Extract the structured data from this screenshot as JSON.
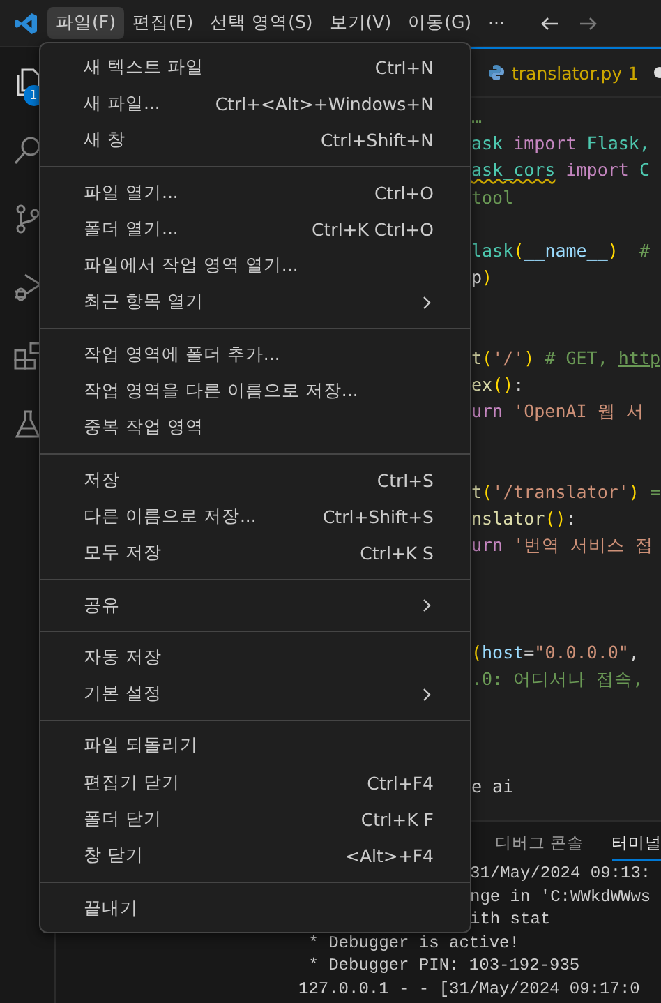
{
  "title_bar": {
    "menus": [
      {
        "label": "파일(F)",
        "selected": true
      },
      {
        "label": "편집(E)",
        "selected": false
      },
      {
        "label": "선택 영역(S)",
        "selected": false
      },
      {
        "label": "보기(V)",
        "selected": false
      },
      {
        "label": "이동(G)",
        "selected": false
      },
      {
        "label": "···",
        "selected": false
      }
    ]
  },
  "activity_bar": {
    "items": [
      {
        "kind": "files",
        "badge": "1"
      },
      {
        "kind": "search"
      },
      {
        "kind": "source-control"
      },
      {
        "kind": "debug"
      },
      {
        "kind": "extensions"
      },
      {
        "kind": "testing"
      }
    ]
  },
  "editor": {
    "tab": {
      "label": "translator.py 1",
      "modified": true
    },
    "lines": [
      {
        "kind": "code",
        "tokens": [
          {
            "kind": "comment",
            "text": "…"
          }
        ]
      },
      {
        "kind": "code",
        "tokens": [
          {
            "kind": "type",
            "text": "ask"
          },
          {
            "kind": "keyword",
            "text": " import "
          },
          {
            "kind": "type",
            "text": "Flask,"
          }
        ]
      },
      {
        "kind": "code",
        "tokens": [
          {
            "kind": "warning",
            "text": "ask_cors"
          },
          {
            "kind": "keyword",
            "text": " import "
          },
          {
            "kind": "type",
            "text": "C"
          }
        ]
      },
      {
        "kind": "code",
        "tokens": [
          {
            "kind": "comment",
            "text": "tool"
          }
        ]
      },
      {
        "kind": "blank"
      },
      {
        "kind": "code",
        "tokens": [
          {
            "kind": "type",
            "text": "lask"
          },
          {
            "kind": "bracket",
            "text": "("
          },
          {
            "kind": "variable",
            "text": "__name__"
          },
          {
            "kind": "bracket",
            "text": ")"
          },
          {
            "kind": "comment",
            "text": "  #"
          }
        ]
      },
      {
        "kind": "code",
        "tokens": [
          {
            "kind": "plain",
            "text": "p"
          },
          {
            "kind": "bracket",
            "text": ")"
          }
        ]
      },
      {
        "kind": "blank"
      },
      {
        "kind": "blank"
      },
      {
        "kind": "code",
        "tokens": [
          {
            "kind": "function",
            "text": "t"
          },
          {
            "kind": "bracket",
            "text": "("
          },
          {
            "kind": "string",
            "text": "'/'"
          },
          {
            "kind": "bracket",
            "text": ")"
          },
          {
            "kind": "comment",
            "text": " # GET, "
          },
          {
            "kind": "link",
            "text": "http"
          }
        ]
      },
      {
        "kind": "code",
        "tokens": [
          {
            "kind": "function",
            "text": "ex"
          },
          {
            "kind": "bracket",
            "text": "()"
          },
          {
            "kind": "plain",
            "text": ":"
          }
        ]
      },
      {
        "kind": "code",
        "tokens": [
          {
            "kind": "keyword",
            "text": "urn"
          },
          {
            "kind": "string",
            "text": " 'OpenAI 웹 서"
          }
        ]
      },
      {
        "kind": "blank"
      },
      {
        "kind": "blank"
      },
      {
        "kind": "code",
        "tokens": [
          {
            "kind": "function",
            "text": "t"
          },
          {
            "kind": "bracket",
            "text": "("
          },
          {
            "kind": "string",
            "text": "'/translator'"
          },
          {
            "kind": "bracket",
            "text": ")"
          },
          {
            "kind": "comment",
            "text": " ="
          }
        ]
      },
      {
        "kind": "code",
        "tokens": [
          {
            "kind": "function",
            "text": "nslator"
          },
          {
            "kind": "bracket",
            "text": "()"
          },
          {
            "kind": "plain",
            "text": ":"
          }
        ]
      },
      {
        "kind": "code",
        "tokens": [
          {
            "kind": "keyword",
            "text": "urn"
          },
          {
            "kind": "string",
            "text": " '번역 서비스 접"
          }
        ]
      },
      {
        "kind": "blank"
      },
      {
        "kind": "blank"
      },
      {
        "kind": "blank"
      },
      {
        "kind": "code",
        "tokens": [
          {
            "kind": "bracket",
            "text": "("
          },
          {
            "kind": "variable",
            "text": "host"
          },
          {
            "kind": "plain",
            "text": "="
          },
          {
            "kind": "string",
            "text": "\"0.0.0.0\""
          },
          {
            "kind": "plain",
            "text": ","
          }
        ]
      },
      {
        "kind": "code",
        "tokens": [
          {
            "kind": "comment",
            "text": ".0: 어디서나 접속,"
          }
        ]
      },
      {
        "kind": "blank"
      },
      {
        "kind": "blank"
      },
      {
        "kind": "blank"
      },
      {
        "kind": "code",
        "tokens": [
          {
            "kind": "plain",
            "text": "e ai"
          }
        ]
      }
    ]
  },
  "panel": {
    "tabs": [
      {
        "label": "디버그 콘솔",
        "selected": false
      },
      {
        "label": "터미널",
        "selected": true
      }
    ],
    "terminal_lines": [
      {
        "kind": "clipped",
        "text": "31/May/2024 09:13:"
      },
      {
        "kind": "clipped",
        "text": "nge in 'C:WWkdWWws"
      },
      {
        "kind": "clipped",
        "text": "ith stat"
      },
      {
        "kind": "full",
        "text": " * Debugger is active!"
      },
      {
        "kind": "full",
        "text": " * Debugger PIN: 103-192-935"
      },
      {
        "kind": "full",
        "text": "127.0.0.1 - - [31/May/2024 09:17:0"
      }
    ]
  },
  "file_menu": {
    "groups": [
      [
        {
          "label": "새 텍스트 파일",
          "shortcut": "Ctrl+N",
          "submenu": false
        },
        {
          "label": "새 파일...",
          "shortcut": "Ctrl+<Alt>+Windows+N",
          "submenu": false
        },
        {
          "label": "새 창",
          "shortcut": "Ctrl+Shift+N",
          "submenu": false
        }
      ],
      [
        {
          "label": "파일 열기...",
          "shortcut": "Ctrl+O",
          "submenu": false
        },
        {
          "label": "폴더 열기...",
          "shortcut": "Ctrl+K Ctrl+O",
          "submenu": false
        },
        {
          "label": "파일에서 작업 영역 열기...",
          "submenu": false
        },
        {
          "label": "최근 항목 열기",
          "submenu": true
        }
      ],
      [
        {
          "label": "작업 영역에 폴더 추가...",
          "submenu": false
        },
        {
          "label": "작업 영역을 다른 이름으로 저장...",
          "submenu": false
        },
        {
          "label": "중복 작업 영역",
          "submenu": false
        }
      ],
      [
        {
          "label": "저장",
          "shortcut": "Ctrl+S",
          "submenu": false
        },
        {
          "label": "다른 이름으로 저장...",
          "shortcut": "Ctrl+Shift+S",
          "submenu": false
        },
        {
          "label": "모두 저장",
          "shortcut": "Ctrl+K S",
          "submenu": false
        }
      ],
      [
        {
          "label": "공유",
          "submenu": true
        }
      ],
      [
        {
          "label": "자동 저장",
          "submenu": false
        },
        {
          "label": "기본 설정",
          "submenu": true
        }
      ],
      [
        {
          "label": "파일 되돌리기",
          "submenu": false
        },
        {
          "label": "편집기 닫기",
          "shortcut": "Ctrl+F4",
          "submenu": false
        },
        {
          "label": "폴더 닫기",
          "shortcut": "Ctrl+K F",
          "submenu": false
        },
        {
          "label": "창 닫기",
          "shortcut": "<Alt>+F4",
          "submenu": false
        }
      ],
      [
        {
          "label": "끝내기",
          "submenu": false
        }
      ]
    ]
  }
}
